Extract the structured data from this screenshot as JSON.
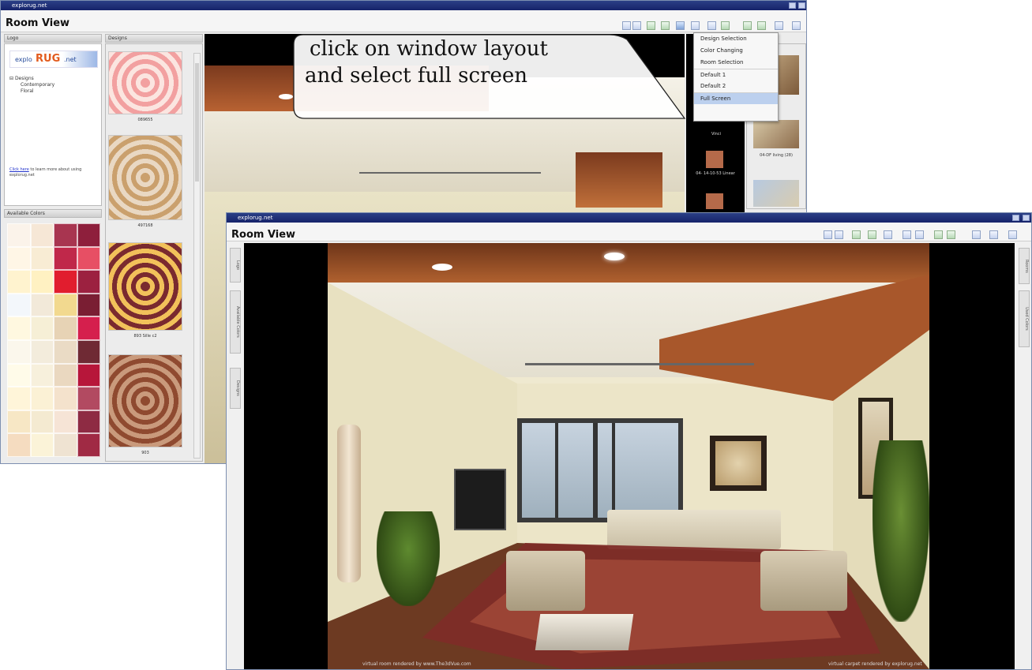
{
  "back_window": {
    "title": "explorug.net",
    "app_title": "Room View",
    "logo_panel": {
      "header": "Logo",
      "brand": "explo",
      "brand_accent": "RUG",
      "brand_suffix": ".net",
      "tree_root": "Designs",
      "tree_items": [
        "Contemporary",
        "Floral"
      ],
      "help_link": "Click here",
      "help_text": "to learn more about using explorug.net"
    },
    "colors_panel": {
      "header": "Available Colors",
      "swatches": [
        "#fbf3ea",
        "#f6e7d6",
        "#a83550",
        "#8e1f3c",
        "#fff6e6",
        "#f8ecd4",
        "#c0284a",
        "#e74f64",
        "#fff3cf",
        "#fff1c2",
        "#e11d2e",
        "#9c2140",
        "#f3f7fb",
        "#f2e9d9",
        "#f2d98f",
        "#7a1e33",
        "#fff8e0",
        "#f6efd6",
        "#e7d3b5",
        "#d51f4d",
        "#fbf7ec",
        "#f3ecdc",
        "#eadbc5",
        "#6f2a34",
        "#fffbe9",
        "#f7f0dc",
        "#ead8c0",
        "#b7163a",
        "#fff5d9",
        "#fbf1d5",
        "#f4e2cc",
        "#b24a61",
        "#f7e7c5",
        "#f4ead1",
        "#f6e4d6",
        "#8e2b43",
        "#f5dcc0",
        "#fbf3d8",
        "#efe3d2",
        "#a02a44"
      ]
    },
    "designs_panel": {
      "header": "Designs",
      "items": [
        {
          "label": "089655",
          "color_a": "#f2a0a0",
          "color_b": "#fbe5e0"
        },
        {
          "label": "497168",
          "color_a": "#caa06d",
          "color_b": "#e9d8c3"
        },
        {
          "label": "893 Sille c2",
          "color_a": "#7a2a2f",
          "color_b": "#f2c15a"
        },
        {
          "label": "903",
          "color_a": "#8f4a30",
          "color_b": "#c99a7c"
        }
      ]
    },
    "menu": {
      "items": [
        "Design Selection",
        "Color Changing",
        "Room Selection",
        "Default 1",
        "Default 2",
        "Full Screen"
      ],
      "selected": "Full Screen"
    },
    "right_panel": {
      "labels": [
        "Vinci",
        "04- 14-10-53 Linear"
      ],
      "room_labels": [
        "04-DF living (28)"
      ]
    },
    "scene_colors": {
      "ceiling": "#f1eee3",
      "wall": "#e8e2c5",
      "beam": "#a8542a"
    }
  },
  "callout": {
    "line1": "click on window layout",
    "line2": "and select full screen"
  },
  "front_window": {
    "title": "explorug.net",
    "app_title": "Room View",
    "left_tabs": [
      "Logo",
      "Available Colors",
      "Designs"
    ],
    "right_tabs": [
      "Rooms",
      "Used Colors"
    ],
    "caption_left": "virtual room rendered by www.The3dVue.com",
    "caption_right": "virtual carpet rendered by explorug.net"
  }
}
